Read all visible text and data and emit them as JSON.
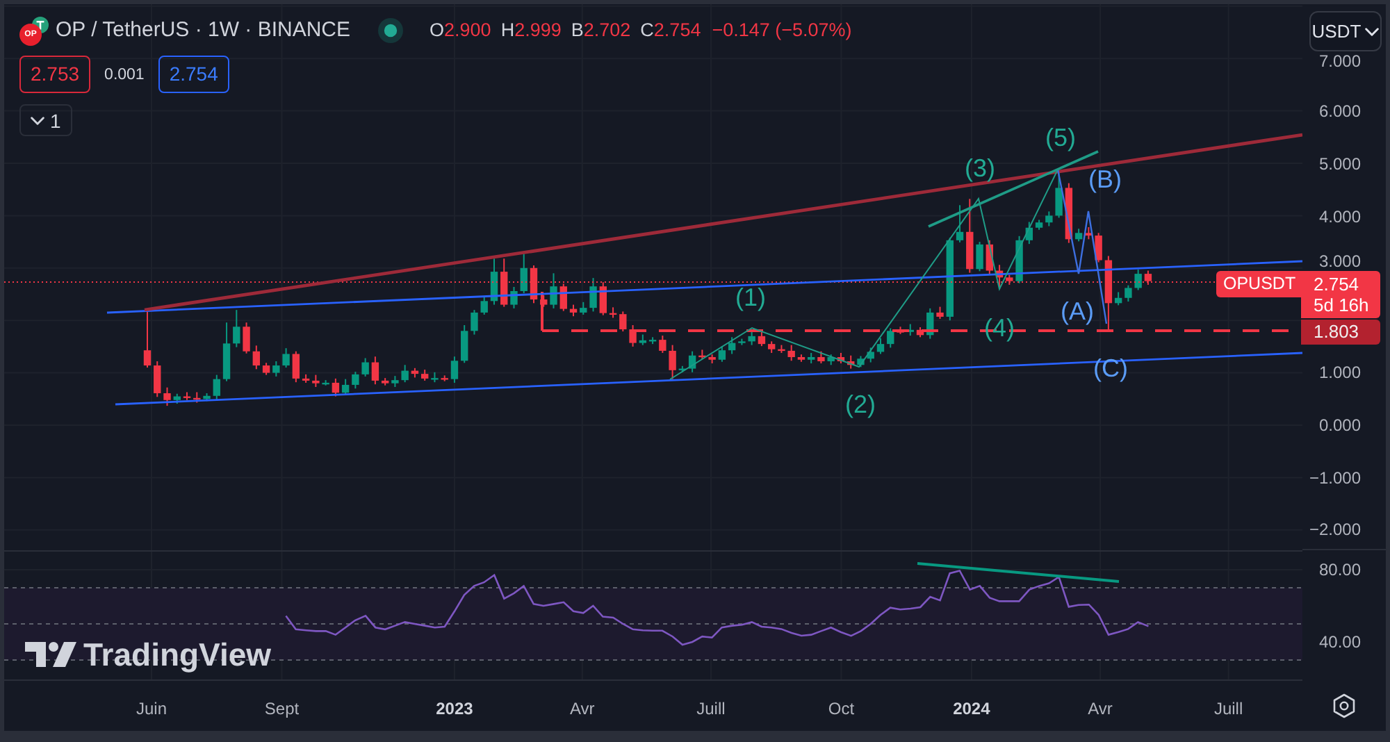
{
  "legend": {
    "logo": "OP",
    "symbol": "OP / TetherUS · 1W · BINANCE",
    "market_open": true,
    "change_negative": true,
    "ohlc": [
      {
        "key": "O",
        "value": "2.900"
      },
      {
        "key": "H",
        "value": "2.999"
      },
      {
        "key": "B",
        "value": "2.702"
      },
      {
        "key": "C",
        "value": "2.754"
      }
    ],
    "change": "−0.147 (−5.07%)"
  },
  "trade": {
    "sell": "2.753",
    "spread": "0.001",
    "buy": "2.754"
  },
  "indicators_button": {
    "label": "1"
  },
  "currency_button": {
    "label": "USDT"
  },
  "price_axis": {
    "labels": [
      "7.000",
      "6.000",
      "5.000",
      "4.000",
      "3.000",
      "1.000",
      "0.000",
      "−1.000",
      "−2.000"
    ]
  },
  "price_tags": {
    "symbol": "OPUSDT",
    "last_price": "2.754",
    "countdown": "5d 16h",
    "level": "1.803"
  },
  "wave_labels": [
    {
      "text": "(1)",
      "color": "#22ab94"
    },
    {
      "text": "(2)",
      "color": "#22ab94"
    },
    {
      "text": "(3)",
      "color": "#22ab94"
    },
    {
      "text": "(4)",
      "color": "#22ab94"
    },
    {
      "text": "(5)",
      "color": "#22ab94"
    },
    {
      "text": "(A)",
      "color": "#5b9cf6"
    },
    {
      "text": "(B)",
      "color": "#5b9cf6"
    },
    {
      "text": "(C)",
      "color": "#5b9cf6"
    }
  ],
  "rsi_pane": {
    "chart_data": {
      "type": "line",
      "grid": true,
      "xlim": [
        2022.129,
        2024.64
      ],
      "ylim": [
        18.5,
        90.8
      ],
      "xticks": [
        {
          "value": 2022.414,
          "label": "Juin"
        },
        {
          "value": 2022.666,
          "label": "Sept"
        },
        {
          "value": 2023,
          "label": "2023"
        },
        {
          "value": 2023.247,
          "label": "Avr"
        },
        {
          "value": 2023.496,
          "label": "Juill"
        },
        {
          "value": 2023.748,
          "label": "Oct"
        },
        {
          "value": 2024,
          "label": "2024"
        },
        {
          "value": 2024.249,
          "label": "Avr"
        },
        {
          "value": 2024.497,
          "label": "Juill"
        }
      ],
      "yticks": [
        {
          "value": 80,
          "label": "80.00"
        },
        {
          "value": 40,
          "label": "40.00"
        }
      ],
      "bands": [
        {
          "axis": "y",
          "from": 30,
          "to": 70
        }
      ],
      "ref_lines": [
        {
          "axis": "y",
          "value": 70
        },
        {
          "axis": "y",
          "value": 50
        },
        {
          "axis": "y",
          "value": 30
        }
      ],
      "x": [
        2022.674,
        2022.693,
        2022.713,
        2022.732,
        2022.751,
        2022.77,
        2022.789,
        2022.808,
        2022.828,
        2022.847,
        2022.866,
        2022.885,
        2022.904,
        2022.923,
        2022.943,
        2022.962,
        2022.981,
        2023,
        2023.019,
        2023.038,
        2023.057,
        2023.077,
        2023.096,
        2023.115,
        2023.134,
        2023.153,
        2023.172,
        2023.192,
        2023.211,
        2023.23,
        2023.249,
        2023.268,
        2023.287,
        2023.307,
        2023.326,
        2023.345,
        2023.364,
        2023.383,
        2023.402,
        2023.422,
        2023.441,
        2023.46,
        2023.479,
        2023.498,
        2023.517,
        2023.537,
        2023.556,
        2023.575,
        2023.594,
        2023.613,
        2023.632,
        2023.652,
        2023.671,
        2023.69,
        2023.709,
        2023.728,
        2023.747,
        2023.767,
        2023.786,
        2023.805,
        2023.824,
        2023.843,
        2023.862,
        2023.882,
        2023.901,
        2023.92,
        2023.939,
        2023.958,
        2023.977,
        2023.997,
        2024.016,
        2024.035,
        2024.054,
        2024.073,
        2024.092,
        2024.112,
        2024.131,
        2024.15,
        2024.169,
        2024.188,
        2024.207,
        2024.227,
        2024.246,
        2024.265,
        2024.284,
        2024.303,
        2024.322,
        2024.342
      ],
      "values": [
        54.5,
        47,
        46.5,
        46,
        46,
        44,
        48,
        52,
        54.5,
        48,
        47,
        49,
        51,
        50,
        49,
        48,
        48.5,
        57,
        66,
        71,
        73,
        77,
        64,
        67,
        71,
        61,
        60,
        61,
        62,
        57,
        56,
        60,
        54,
        53.5,
        50,
        47,
        46.5,
        46.3,
        46.3,
        43,
        38.5,
        40,
        43,
        42.5,
        48,
        49,
        49.6,
        51,
        48.5,
        48,
        47.2,
        45,
        43.5,
        44,
        46,
        48,
        45.5,
        43.4,
        46,
        50,
        55,
        59,
        58,
        58.5,
        59.3,
        65,
        63,
        78,
        79.5,
        69,
        71,
        64.5,
        62.6,
        62.6,
        62.6,
        69,
        71,
        72.5,
        76,
        59.5,
        60.5,
        60.7,
        55,
        44,
        45.5,
        47.2,
        51,
        48.7
      ]
    }
  },
  "time_axis": {
    "bold": [
      false,
      false,
      true,
      false,
      false,
      false,
      true,
      false,
      false
    ]
  },
  "brand": {
    "text": "TradingView"
  }
}
